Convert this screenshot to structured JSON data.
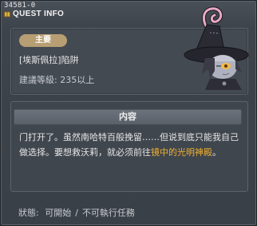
{
  "quest_id": "34581-0",
  "window_title": "QUEST INFO",
  "quest": {
    "type_badge": "主要",
    "name": "[埃斯佩拉]陷阱",
    "level_req": "建議等級: 235以上"
  },
  "content": {
    "header": "内容",
    "text_plain": "门打开了。虽然南哈特百般挽留……但说到底只能我自己做选择。要想救沃莉，就必须前往",
    "text_highlight": "镜中的光明神殿",
    "text_end": "。"
  },
  "status": {
    "label": "狀態:",
    "can_start": "可開始",
    "cannot_execute": "不可執行任務"
  },
  "colors": {
    "badge": "#b79e73",
    "highlight": "#f0b030",
    "panel": "#444a52",
    "header_bar": "#5a6169"
  },
  "icons": {
    "title": "quest-book-icon",
    "npc": "witch-npc-portrait"
  }
}
